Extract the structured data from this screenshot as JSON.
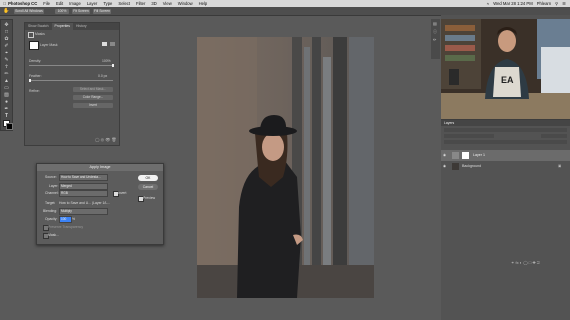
{
  "menubar": {
    "apple": "",
    "app": "Photoshop CC",
    "items": [
      "File",
      "Edit",
      "Image",
      "Layer",
      "Type",
      "Select",
      "Filter",
      "3D",
      "View",
      "Window",
      "Help"
    ],
    "datetime": "Wed Mar 28  1:24 PM",
    "user": "Phlearn"
  },
  "optionsbar": {
    "b1": "Scroll All Windows",
    "b2": "100%",
    "b3": "Fit Screen",
    "b4": "Fill Screen"
  },
  "props": {
    "tabs": [
      "Show Swatch",
      "Properties",
      "History"
    ],
    "section": "Masks",
    "mask_label": "Layer Mask",
    "density_label": "Density:",
    "density_value": "100%",
    "feather_label": "Feather:",
    "feather_value": "0.0 px",
    "refine_label": "Refine:",
    "btn_select": "Select and Mask...",
    "btn_color": "Color Range...",
    "btn_invert": "Invert"
  },
  "dialog": {
    "title": "Apply Image",
    "source_label": "Source:",
    "source_value": "How to Save and Undesta...",
    "layer_label": "Layer:",
    "layer_value": "Merged",
    "channel_label": "Channel:",
    "channel_value": "RGB",
    "invert_label": "Invert",
    "target_label": "Target:",
    "target_value": "How to Save and U... (Layer 1/L...",
    "blending_label": "Blending:",
    "blending_value": "Multiply",
    "opacity_label": "Opacity:",
    "opacity_value": "100",
    "opacity_unit": "%",
    "preserve_label": "Preserve Transparency",
    "mask_label": "Mask...",
    "ok_label": "OK",
    "cancel_label": "Cancel",
    "preview_label": "Preview"
  },
  "layers": {
    "tab": "Layers",
    "rows": [
      {
        "name": "Layer 1"
      },
      {
        "name": "Background"
      }
    ]
  },
  "colors": {
    "accent": "#3b82f6",
    "panel": "#535353",
    "workspace": "#5a5a5a"
  }
}
